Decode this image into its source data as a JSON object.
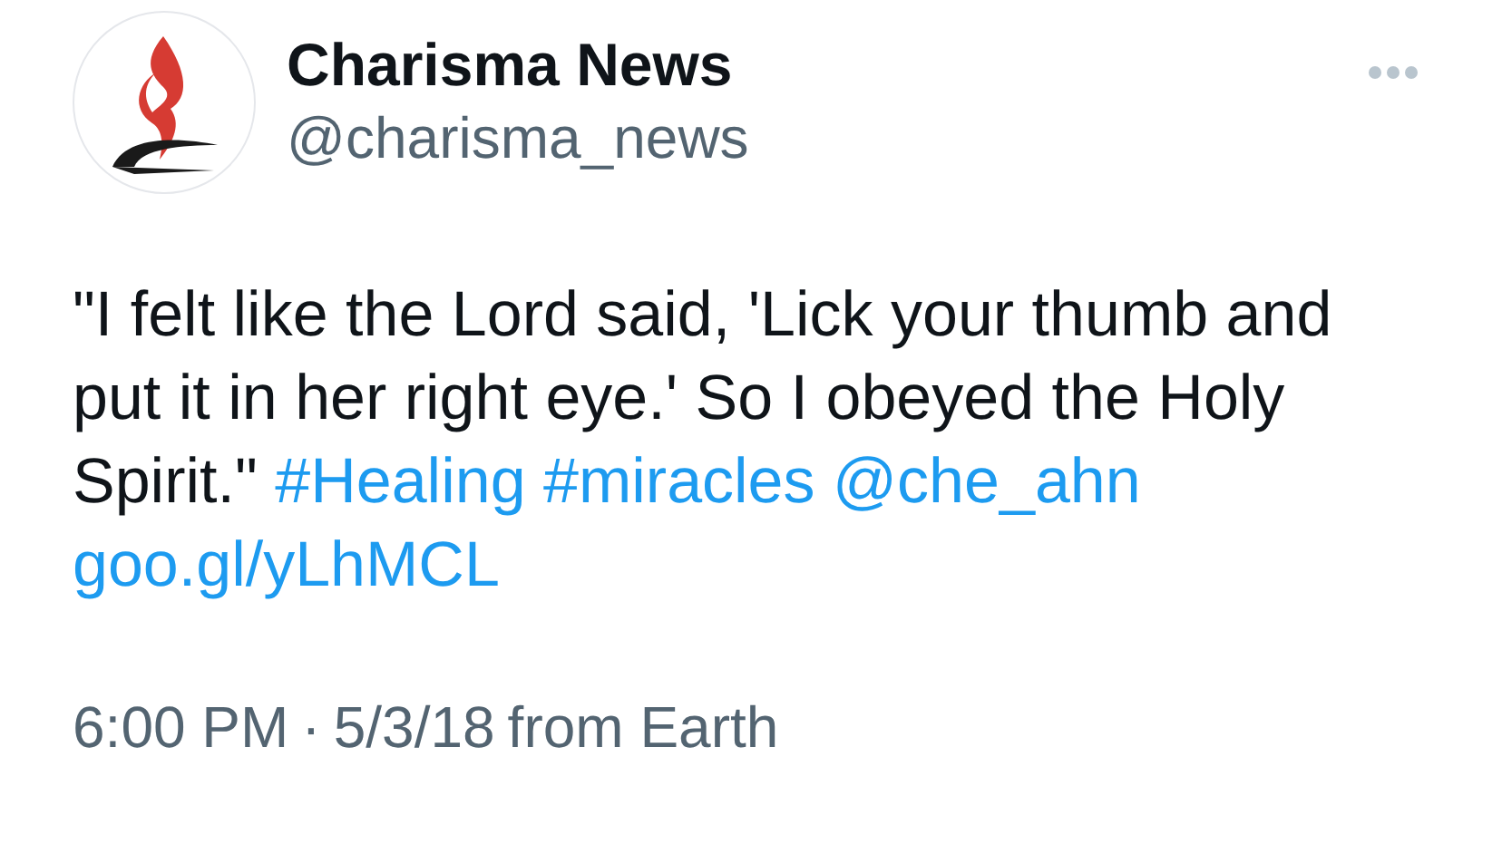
{
  "author": {
    "name": "Charisma News",
    "handle": "@charisma_news"
  },
  "tweet": {
    "segments": [
      {
        "kind": "text",
        "text": "\"I felt like the Lord said, 'Lick your thumb and put it in her right eye.' So I obeyed the Holy Spirit.\""
      },
      {
        "kind": "link",
        "text": "#Healing"
      },
      {
        "kind": "link",
        "text": "#miracles"
      },
      {
        "kind": "link",
        "text": "@che_ahn"
      },
      {
        "kind": "link",
        "text": "goo.gl/yLhMCL"
      }
    ]
  },
  "footer": {
    "time": "6:00 PM",
    "separator": "·",
    "date": "5/3/18",
    "source": "from Earth"
  }
}
